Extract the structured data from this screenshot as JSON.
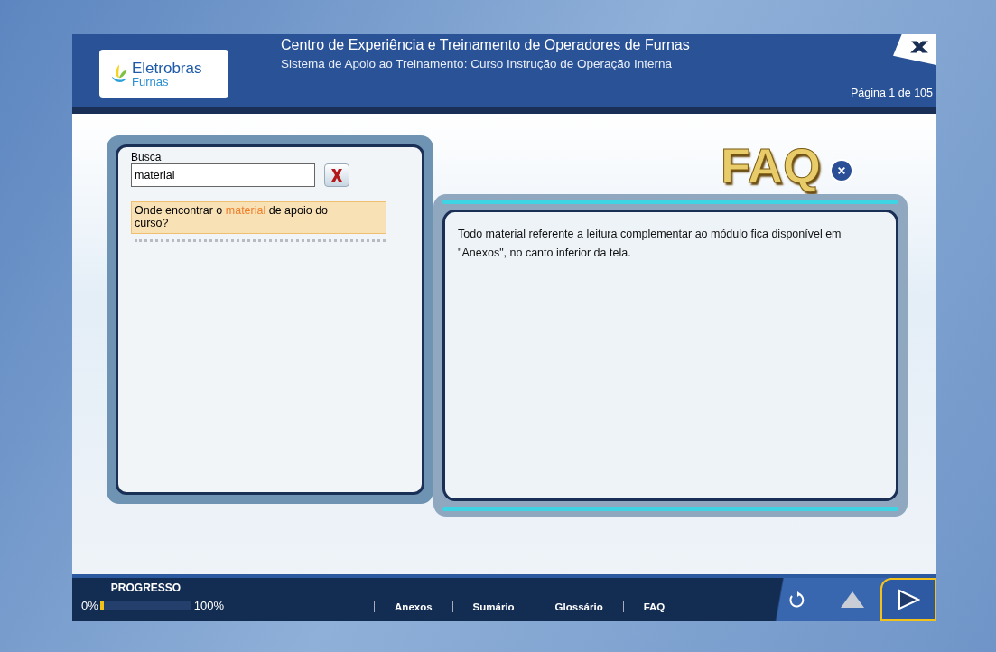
{
  "header": {
    "logo_name": "Eletrobras",
    "logo_sub": "Furnas",
    "title": "Centro de Experiência e Treinamento de Operadores de Furnas",
    "subtitle": "Sistema de Apoio ao Treinamento: Curso Instrução de Operação Interna",
    "page": "Página 1 de 105"
  },
  "search": {
    "label": "Busca",
    "value": "material"
  },
  "results": [
    {
      "selected": true,
      "parts": [
        {
          "text": "Onde encontrar o ",
          "highlight": false
        },
        {
          "text": "material",
          "highlight": true
        },
        {
          "text": " de apoio do curso?",
          "highlight": false
        }
      ]
    }
  ],
  "faq": {
    "title": "FAQ",
    "answer": "Todo material referente a leitura complementar ao módulo fica disponível em \"Anexos\", no canto inferior da tela."
  },
  "footer": {
    "progress_label": "PROGRESSO",
    "start": "0%",
    "end": "100%",
    "level": 0.04,
    "links": [
      "Anexos",
      "Sumário",
      "Glossário",
      "FAQ"
    ]
  }
}
